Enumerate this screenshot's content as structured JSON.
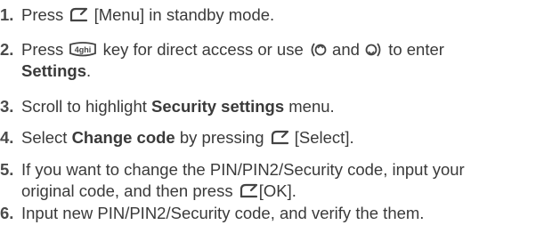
{
  "steps": [
    {
      "number": "1.",
      "text_a": "Press",
      "key_icon": "soft-left-key-icon",
      "text_b": "[Menu] in standby mode."
    },
    {
      "number": "2.",
      "text_a": "Press",
      "key_label": "4ghi",
      "text_b": "key for direct access or use",
      "text_c": "and",
      "text_d": "to enter",
      "bold_a": "Settings",
      "text_e": "."
    },
    {
      "number": "3.",
      "text_a": "Scroll to highlight",
      "bold_a": "Security settings",
      "text_b": "menu."
    },
    {
      "number": "4.",
      "text_a": "Select",
      "bold_a": "Change code",
      "text_b": "by pressing",
      "text_c": "[Select]."
    },
    {
      "number": "5.",
      "line1": "If you want to change the PIN/PIN2/Security code, input your",
      "line2": "original code, and then press",
      "text_c": "[OK]."
    },
    {
      "number": "6.",
      "text_a": "Input new PIN/PIN2/Security code, and verify the them."
    }
  ],
  "colors": {
    "text": "#3a3a3a",
    "icon": "#444444",
    "background": "#ffffff"
  }
}
